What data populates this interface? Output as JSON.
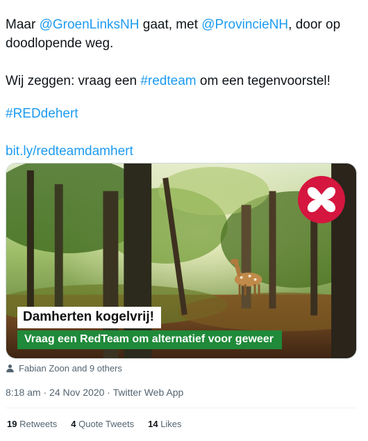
{
  "tweet": {
    "line1_prefix": "Maar ",
    "mention1": "@GroenLinksNH",
    "line1_mid": " gaat, met ",
    "mention2": "@ProvincieNH",
    "line1_suffix": ", door op doodlopende weg.",
    "line2_prefix": "Wij zeggen: vraag een ",
    "hashtag1": "#redteam",
    "line2_suffix": " om een tegenvoorstel!",
    "hashtag2": "#REDdehert",
    "link": "bit.ly/redteamdamhert"
  },
  "media": {
    "caption_title": "Damherten kogelvrij!",
    "caption_subtitle": "Vraag een RedTeam om alternatief voor geweer",
    "logo_icon": "redteam-x-logo",
    "brand_color": "#d5163f",
    "caption_green": "#1f8a3a"
  },
  "tagged": {
    "icon": "person-icon",
    "text": "Fabian Zoon and 9 others"
  },
  "meta": {
    "timestamp": "8:18 am · 24 Nov 2020 · Twitter Web App"
  },
  "stats": {
    "retweets_count": "19",
    "retweets_label": " Retweets",
    "quotes_count": "4",
    "quotes_label": " Quote Tweets",
    "likes_count": "14",
    "likes_label": " Likes"
  },
  "colors": {
    "link": "#1d9bf0",
    "text": "#0f1419",
    "secondary": "#536471"
  }
}
